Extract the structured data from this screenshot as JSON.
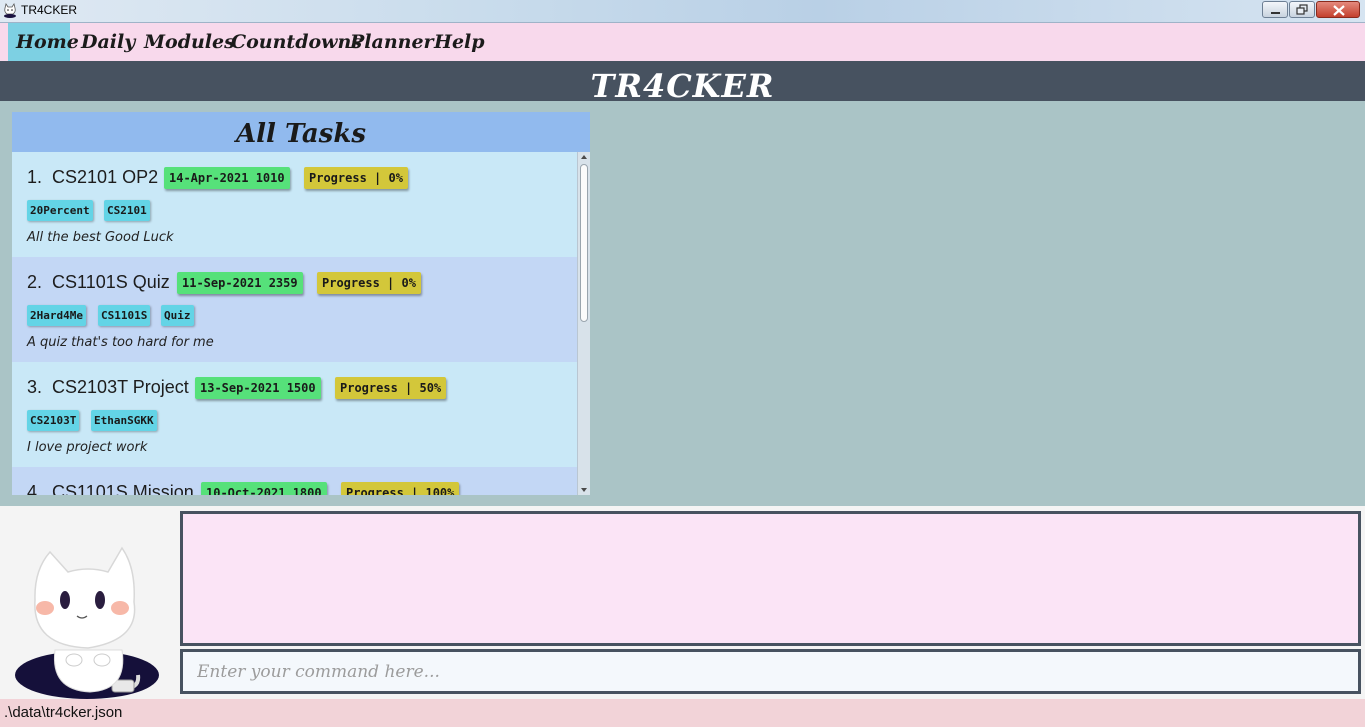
{
  "window": {
    "title": "TR4CKER",
    "app_icon": "cat-icon"
  },
  "menu": {
    "items": [
      {
        "label": "Home",
        "active": true
      },
      {
        "label": "Daily",
        "active": false
      },
      {
        "label": "Modules",
        "active": false
      },
      {
        "label": "Countdowns",
        "active": false
      },
      {
        "label": "Planner",
        "active": false
      },
      {
        "label": "Help",
        "active": false
      }
    ]
  },
  "banner": {
    "title": "TR4CKER"
  },
  "task_panel": {
    "title": "All Tasks",
    "tasks": [
      {
        "index": "1.",
        "name": "CS2101 OP2",
        "deadline": "14-Apr-2021 1010",
        "progress": "Progress | 0%",
        "tags": [
          "20Percent",
          "CS2101"
        ],
        "description": "All the best Good Luck"
      },
      {
        "index": "2.",
        "name": "CS1101S Quiz",
        "deadline": "11-Sep-2021 2359",
        "progress": "Progress | 0%",
        "tags": [
          "2Hard4Me",
          "CS1101S",
          "Quiz"
        ],
        "description": "A quiz that's too hard for me"
      },
      {
        "index": "3.",
        "name": "CS2103T Project",
        "deadline": "13-Sep-2021 1500",
        "progress": "Progress | 50%",
        "tags": [
          "CS2103T",
          "EthanSGKK"
        ],
        "description": "I love project work"
      },
      {
        "index": "4.",
        "name": "CS1101S Mission",
        "deadline": "10-Oct-2021 1800",
        "progress": "Progress | 100%",
        "tags": [],
        "description": ""
      }
    ]
  },
  "result_display": {
    "text": ""
  },
  "command": {
    "placeholder": "Enter your command here..."
  },
  "status_bar": {
    "path": ".\\data\\tr4cker.json"
  },
  "colors": {
    "menu_bg": "#f8d9ec",
    "menu_active": "#7dd0e3",
    "banner_bg": "#475260",
    "date_chip": "#56e17a",
    "progress_chip": "#d3c73a",
    "tag_chip": "#63d4e6",
    "result_bg": "#fbe4f6",
    "status_bg": "#f2d3d8"
  }
}
